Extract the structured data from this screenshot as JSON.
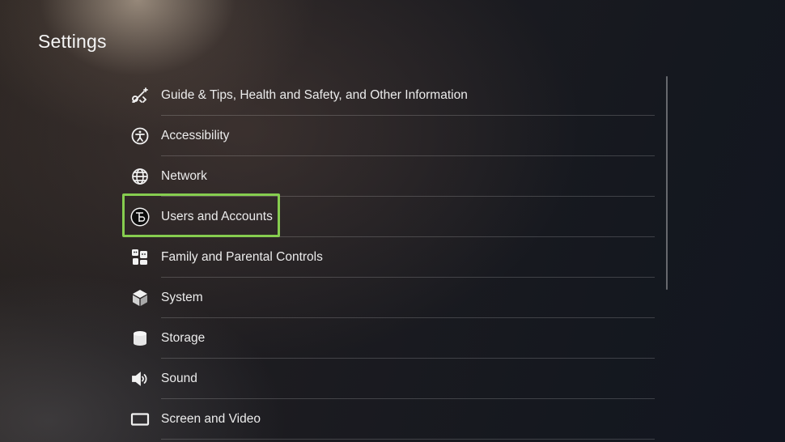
{
  "header": {
    "title": "Settings"
  },
  "settings": {
    "focused_index": 3,
    "items": [
      {
        "label": "Guide & Tips, Health and Safety, and Other Information",
        "icon": "guide-tips-icon"
      },
      {
        "label": "Accessibility",
        "icon": "accessibility-icon"
      },
      {
        "label": "Network",
        "icon": "globe-icon"
      },
      {
        "label": "Users and Accounts",
        "icon": "user-avatar-icon"
      },
      {
        "label": "Family and Parental Controls",
        "icon": "family-controls-icon"
      },
      {
        "label": "System",
        "icon": "cube-icon"
      },
      {
        "label": "Storage",
        "icon": "storage-cylinder-icon"
      },
      {
        "label": "Sound",
        "icon": "speaker-icon"
      },
      {
        "label": "Screen and Video",
        "icon": "screen-icon"
      }
    ]
  },
  "colors": {
    "focus_outline": "#86cd4f",
    "text": "#ececec",
    "divider": "rgba(255,255,255,0.18)"
  }
}
